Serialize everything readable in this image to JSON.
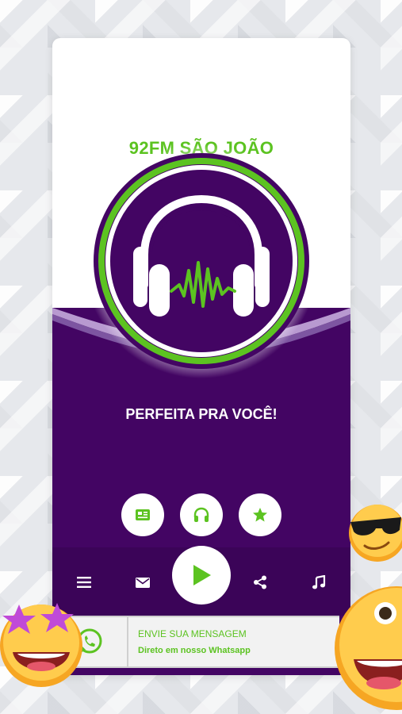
{
  "station": {
    "name": "92FM SÃO JOÃO"
  },
  "tagline": "PERFEITA PRA VOCÊ!",
  "quick_actions": [
    {
      "icon": "news-icon"
    },
    {
      "icon": "headphones-icon"
    },
    {
      "icon": "star-icon"
    }
  ],
  "bottom_bar": {
    "items": [
      "menu-icon",
      "mail-icon",
      "play-icon",
      "share-icon",
      "music-note-icon"
    ]
  },
  "whatsapp_banner": {
    "title": "ENVIE SUA MENSAGEM",
    "subtitle": "Direto em nosso Whatsapp",
    "icon": "whatsapp-icon"
  },
  "colors": {
    "brand_green": "#5cc321",
    "brand_purple": "#430563",
    "bar_purple": "#3b0458",
    "lilac": "#b89ad0"
  },
  "decorations": [
    "star-eyes-emoji",
    "sunglasses-emoji",
    "happy-emoji"
  ]
}
